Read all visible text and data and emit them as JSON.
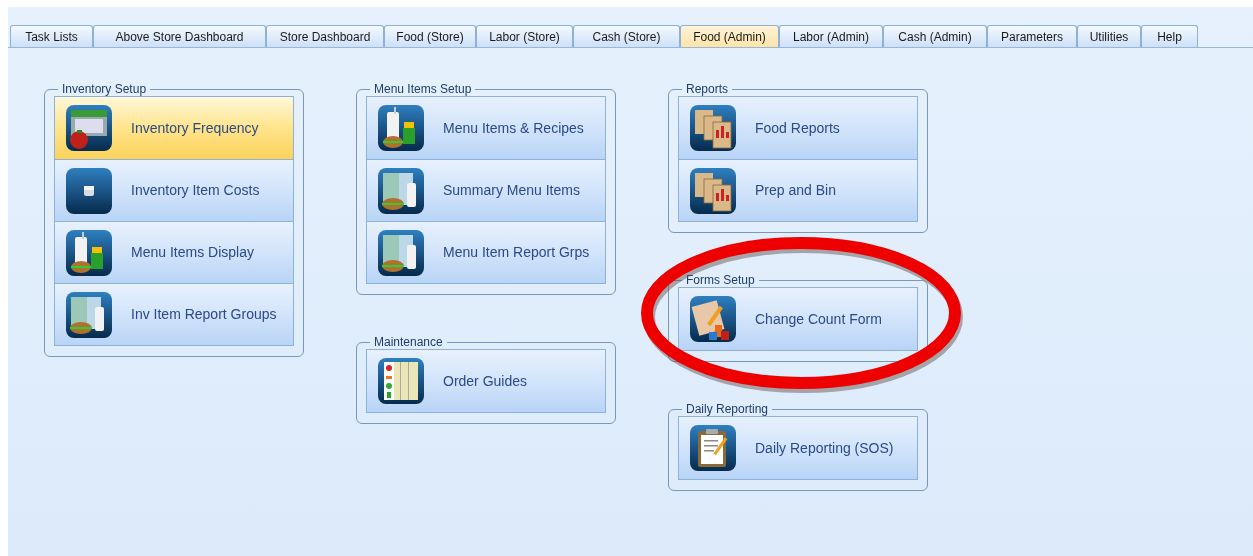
{
  "tabs": [
    {
      "label": "Task Lists",
      "selected": false
    },
    {
      "label": "Above Store Dashboard",
      "selected": false
    },
    {
      "label": "Store Dashboard",
      "selected": false
    },
    {
      "label": "Food (Store)",
      "selected": false
    },
    {
      "label": "Labor (Store)",
      "selected": false
    },
    {
      "label": "Cash (Store)",
      "selected": false
    },
    {
      "label": "Food (Admin)",
      "selected": true
    },
    {
      "label": "Labor (Admin)",
      "selected": false
    },
    {
      "label": "Cash (Admin)",
      "selected": false
    },
    {
      "label": "Parameters",
      "selected": false
    },
    {
      "label": "Utilities",
      "selected": false
    },
    {
      "label": "Help",
      "selected": false
    }
  ],
  "columns": [
    [
      {
        "title": "Inventory Setup",
        "items": [
          {
            "label": "Inventory Frequency",
            "kind": "calendar",
            "selected": true
          },
          {
            "label": "Inventory Item Costs",
            "kind": "cube",
            "selected": false
          },
          {
            "label": "Menu Items Display",
            "kind": "meal",
            "selected": false
          },
          {
            "label": "Inv Item Report Groups",
            "kind": "sheet",
            "selected": false
          }
        ]
      }
    ],
    [
      {
        "title": "Menu Items Setup",
        "items": [
          {
            "label": "Menu Items & Recipes",
            "kind": "meal",
            "selected": false
          },
          {
            "label": "Summary Menu Items",
            "kind": "sheet",
            "selected": false
          },
          {
            "label": "Menu Item Report Grps",
            "kind": "sheet",
            "selected": false
          }
        ]
      },
      {
        "title": "Maintenance",
        "items": [
          {
            "label": "Order Guides",
            "kind": "guide",
            "selected": false
          }
        ]
      }
    ],
    [
      {
        "title": "Reports",
        "items": [
          {
            "label": "Food Reports",
            "kind": "reports",
            "selected": false
          },
          {
            "label": "Prep and Bin",
            "kind": "reports",
            "selected": false
          }
        ]
      },
      {
        "title": "Forms Setup",
        "items": [
          {
            "label": "Change Count Form",
            "kind": "form",
            "selected": false
          }
        ]
      },
      {
        "title": "Daily Reporting",
        "items": [
          {
            "label": "Daily Reporting (SOS)",
            "kind": "clipboard",
            "selected": false
          }
        ]
      }
    ]
  ]
}
